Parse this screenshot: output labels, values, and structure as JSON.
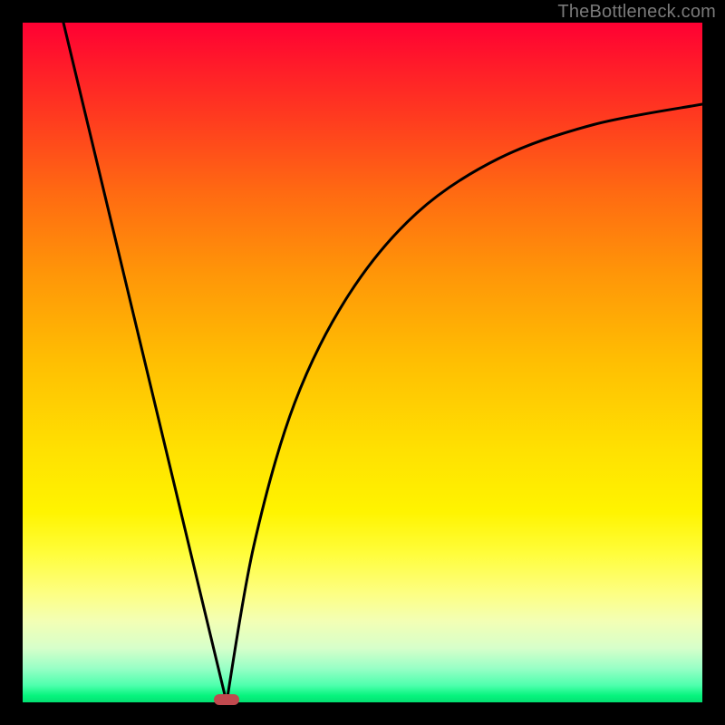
{
  "watermark": "TheBottleneck.com",
  "colors": {
    "frame": "#000000",
    "curve": "#000000",
    "marker": "#c0494e",
    "watermark": "#7a7a7a"
  },
  "chart_data": {
    "type": "line",
    "title": "",
    "xlabel": "",
    "ylabel": "",
    "xlim": [
      0,
      100
    ],
    "ylim": [
      0,
      100
    ],
    "legend": false,
    "axes_visible": false,
    "grid": false,
    "gradient_background": {
      "orientation": "vertical",
      "stops": [
        {
          "pos": 0.0,
          "color": "#ff0033"
        },
        {
          "pos": 0.5,
          "color": "#ffbf02"
        },
        {
          "pos": 0.78,
          "color": "#fffd3a"
        },
        {
          "pos": 1.0,
          "color": "#03e072"
        }
      ]
    },
    "curve": {
      "description": "V-shaped bottleneck curve: steep near-linear drop from top-left to a cusp near the bottom, then a concave rise toward the right that flattens out.",
      "cusp_x": 30,
      "cusp_y": 0,
      "left_segment_points": [
        {
          "x": 6,
          "y": 100
        },
        {
          "x": 30,
          "y": 0
        }
      ],
      "right_segment_points": [
        {
          "x": 30,
          "y": 0
        },
        {
          "x": 34,
          "y": 23
        },
        {
          "x": 40,
          "y": 44
        },
        {
          "x": 48,
          "y": 60
        },
        {
          "x": 58,
          "y": 72
        },
        {
          "x": 70,
          "y": 80
        },
        {
          "x": 84,
          "y": 85
        },
        {
          "x": 100,
          "y": 88
        }
      ]
    },
    "marker": {
      "x": 30,
      "y": 0,
      "shape": "rounded-rect",
      "color": "#c0494e"
    }
  }
}
